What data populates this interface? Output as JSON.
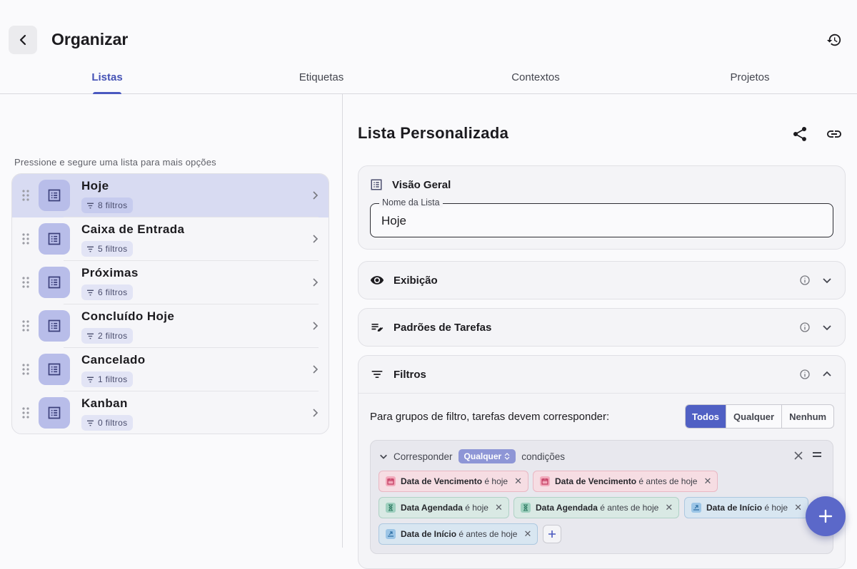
{
  "header": {
    "title": "Organizar"
  },
  "tabs": [
    {
      "label": "Listas",
      "active": true
    },
    {
      "label": "Etiquetas",
      "active": false
    },
    {
      "label": "Contextos",
      "active": false
    },
    {
      "label": "Projetos",
      "active": false
    }
  ],
  "lists": {
    "hint": "Pressione e segure uma lista para mais opções",
    "items": [
      {
        "name": "Hoje",
        "filters": "8 filtros",
        "selected": true
      },
      {
        "name": "Caixa de Entrada",
        "filters": "5 filtros",
        "selected": false
      },
      {
        "name": "Próximas",
        "filters": "6 filtros",
        "selected": false
      },
      {
        "name": "Concluído Hoje",
        "filters": "2 filtros",
        "selected": false
      },
      {
        "name": "Cancelado",
        "filters": "1 filtros",
        "selected": false
      },
      {
        "name": "Kanban",
        "filters": "0 filtros",
        "selected": false
      }
    ]
  },
  "detail": {
    "title": "Lista Personalizada",
    "overview": {
      "label": "Visão Geral",
      "name_label": "Nome da Lista",
      "name_value": "Hoje"
    },
    "display": {
      "label": "Exibição"
    },
    "task_defaults": {
      "label": "Padrões de Tarefas"
    },
    "filters": {
      "label": "Filtros",
      "match_text": "Para grupos de filtro, tarefas devem corresponder:",
      "match_options": [
        "Todos",
        "Qualquer",
        "Nenhum"
      ],
      "match_selected": "Todos",
      "group": {
        "prefix": "Corresponder",
        "mode": "Qualquer",
        "suffix": "condições",
        "tags": [
          {
            "field": "Data de Vencimento",
            "op": "é hoje",
            "color": "pink",
            "icon": "calendar-icon"
          },
          {
            "field": "Data de Vencimento",
            "op": "é antes de hoje",
            "color": "pink",
            "icon": "calendar-icon"
          },
          {
            "field": "Data Agendada",
            "op": "é hoje",
            "color": "green",
            "icon": "hourglass-icon"
          },
          {
            "field": "Data Agendada",
            "op": "é antes de hoje",
            "color": "green",
            "icon": "hourglass-icon"
          },
          {
            "field": "Data de Início",
            "op": "é hoje",
            "color": "blue",
            "icon": "start-icon"
          },
          {
            "field": "Data de Início",
            "op": "é antes de hoje",
            "color": "blue",
            "icon": "start-icon"
          }
        ]
      }
    }
  },
  "colors": {
    "accent": "#4a58bf",
    "fab": "#5b68c9",
    "selected_row": "#d8dbf2",
    "tag_pink": "#f6dde3",
    "tag_green": "#d9e9e4",
    "tag_blue": "#d8e6f1"
  }
}
